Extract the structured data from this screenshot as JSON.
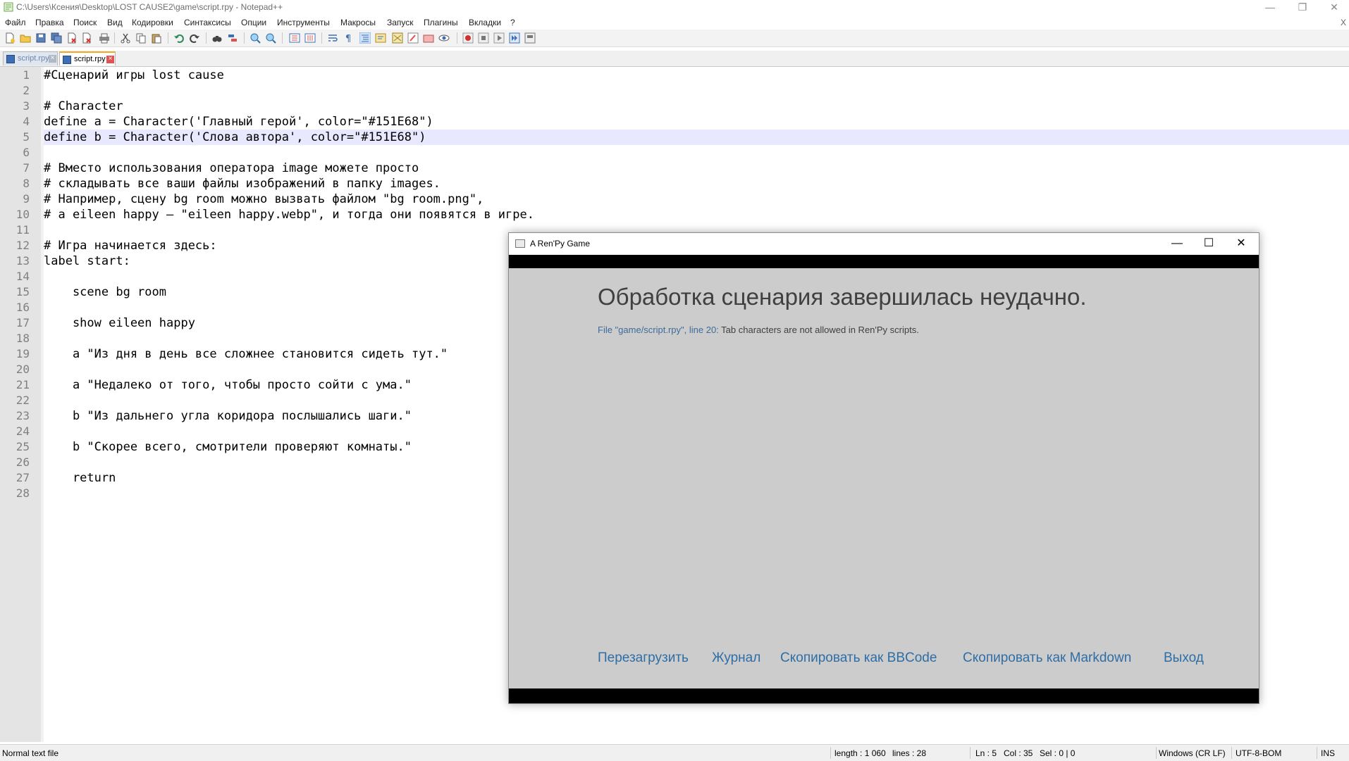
{
  "notepad": {
    "title": "C:\\Users\\Ксения\\Desktop\\LOST CAUSE2\\game\\script.rpy - Notepad++",
    "window_controls": {
      "minimize": "—",
      "restore": "❐",
      "close": "✕"
    },
    "menu": [
      "Файл",
      "Правка",
      "Поиск",
      "Вид",
      "Кодировки",
      "Синтаксисы",
      "Опции",
      "Инструменты",
      "Макросы",
      "Запуск",
      "Плагины",
      "Вкладки",
      "?"
    ],
    "close_x": "X",
    "tabs": [
      {
        "label": "script.rpy",
        "active": false
      },
      {
        "label": "script.rpy",
        "active": true
      }
    ],
    "editor": {
      "lines": [
        "#Сценарий игры lost cause",
        "",
        "# Character",
        "define a = Character('Главный герой', color=\"#151E68\")",
        "define b = Character('Слова автора', color=\"#151E68\")",
        "",
        "# Вместо использования оператора image можете просто",
        "# складывать все ваши файлы изображений в папку images.",
        "# Например, сцену bg room можно вызвать файлом \"bg room.png\",",
        "# а eileen happy — \"eileen happy.webp\", и тогда они появятся в игре.",
        "",
        "# Игра начинается здесь:",
        "label start:",
        "",
        "    scene bg room",
        "",
        "    show eileen happy",
        "",
        "    a \"Из дня в день все сложнее становится сидеть тут.\"",
        "",
        "    a \"Недалеко от того, чтобы просто сойти с ума.\"",
        "",
        "    b \"Из дальнего угла коридора послышались шаги.\"",
        "",
        "    b \"Скорее всего, смотрители проверяют комнаты.\"",
        "",
        "    return",
        ""
      ],
      "line_numbers": [
        "1",
        "2",
        "3",
        "4",
        "5",
        "6",
        "7",
        "8",
        "9",
        "10",
        "11",
        "12",
        "13",
        "14",
        "15",
        "16",
        "17",
        "18",
        "19",
        "20",
        "21",
        "22",
        "23",
        "24",
        "25",
        "26",
        "27",
        "28"
      ],
      "current_line": 5
    },
    "status": {
      "file_type": "Normal text file",
      "length": "length : 1 060",
      "lines": "lines : 28",
      "ln": "Ln : 5",
      "col": "Col : 35",
      "sel": "Sel : 0 | 0",
      "eol": "Windows (CR LF)",
      "encoding": "UTF-8-BOM",
      "mode": "INS"
    }
  },
  "renpy": {
    "title": "A Ren'Py Game",
    "controls": {
      "minimize": "—",
      "maximize": "☐",
      "close": "✕"
    },
    "heading": "Обработка сценария завершилась неудачно.",
    "error_location": "File \"game/script.rpy\", line 20:",
    "error_message": " Tab characters are not allowed in Ren'Py scripts.",
    "buttons": [
      "Перезагрузить",
      "Журнал",
      "Скопировать как BBCode",
      "Скопировать как Markdown",
      "Выход"
    ]
  }
}
